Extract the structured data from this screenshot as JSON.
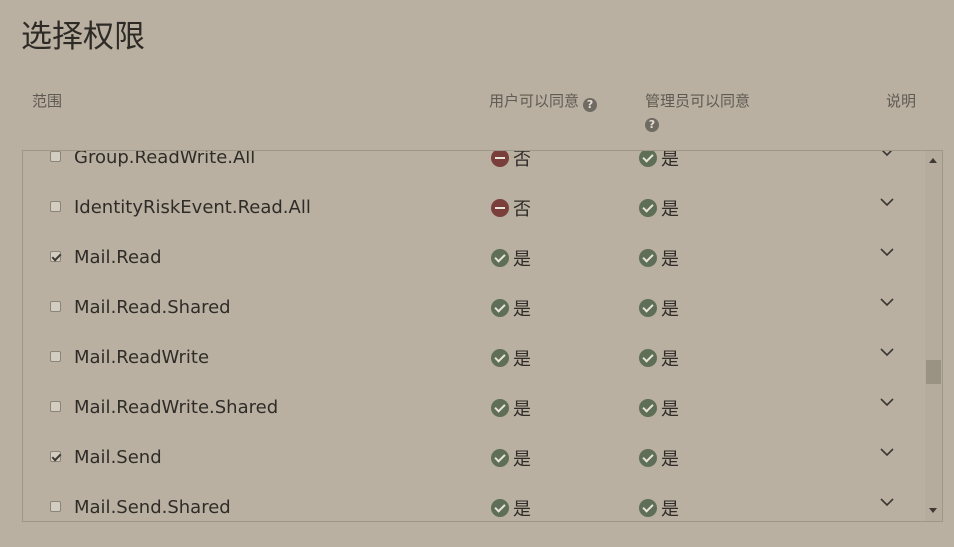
{
  "title": "选择权限",
  "columns": {
    "scope": "范围",
    "user_consent": "用户可以同意",
    "admin_consent": "管理员可以同意",
    "description": "说明",
    "help_glyph": "?"
  },
  "rows": [
    {
      "name": "Group.ReadWrite.All",
      "checked": false,
      "user": "否",
      "user_status": "no",
      "admin": "是",
      "admin_status": "yes"
    },
    {
      "name": "IdentityRiskEvent.Read.All",
      "checked": false,
      "user": "否",
      "user_status": "no",
      "admin": "是",
      "admin_status": "yes"
    },
    {
      "name": "Mail.Read",
      "checked": true,
      "user": "是",
      "user_status": "yes",
      "admin": "是",
      "admin_status": "yes"
    },
    {
      "name": "Mail.Read.Shared",
      "checked": false,
      "user": "是",
      "user_status": "yes",
      "admin": "是",
      "admin_status": "yes"
    },
    {
      "name": "Mail.ReadWrite",
      "checked": false,
      "user": "是",
      "user_status": "yes",
      "admin": "是",
      "admin_status": "yes"
    },
    {
      "name": "Mail.ReadWrite.Shared",
      "checked": false,
      "user": "是",
      "user_status": "yes",
      "admin": "是",
      "admin_status": "yes"
    },
    {
      "name": "Mail.Send",
      "checked": true,
      "user": "是",
      "user_status": "yes",
      "admin": "是",
      "admin_status": "yes"
    },
    {
      "name": "Mail.Send.Shared",
      "checked": false,
      "user": "是",
      "user_status": "yes",
      "admin": "是",
      "admin_status": "yes"
    }
  ],
  "icons": {
    "yes": "check-circle-icon",
    "no": "blocked-circle-icon",
    "expand": "chevron-down-icon"
  },
  "colors": {
    "background": "#b9b0a1",
    "yes_icon": "#5f6e57",
    "no_icon": "#7a3f3a"
  },
  "scroll": {
    "position_fraction": 0.56
  }
}
